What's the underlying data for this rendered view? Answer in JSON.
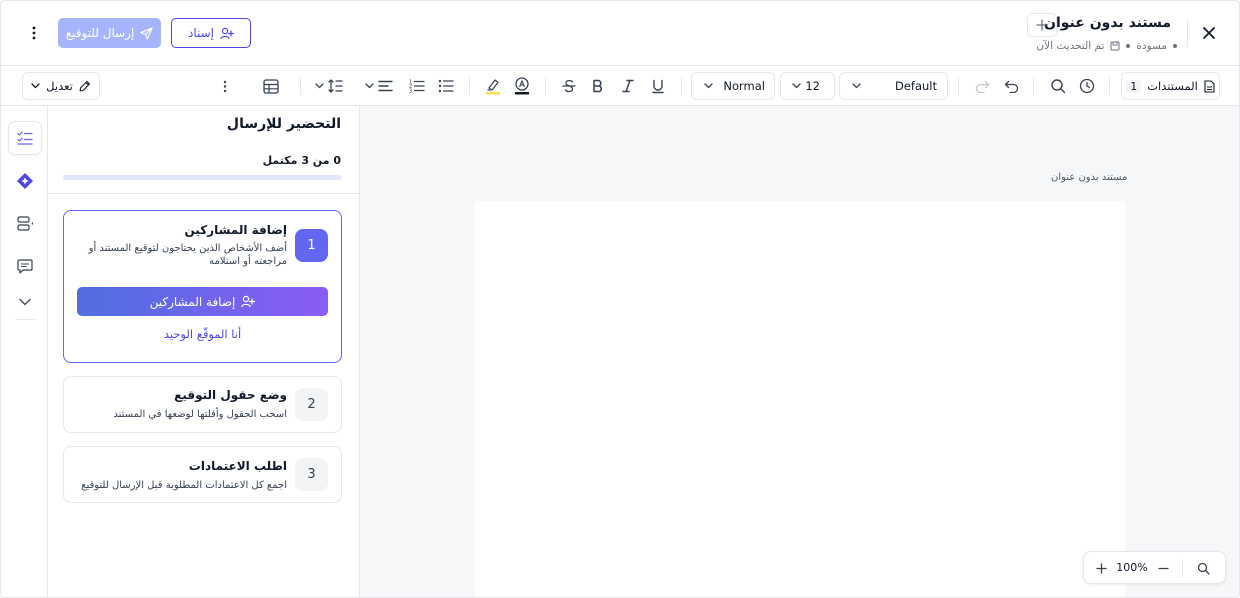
{
  "header": {
    "title": "مستند بدون عنوان",
    "status": "مسودة",
    "updated": "تم التحديث الآن",
    "assign_label": "إسناد",
    "send_label": "إرسال للتوقيع"
  },
  "toolbar": {
    "documents_label": "المستندات",
    "documents_count": "1",
    "font_family": "Default",
    "font_size": "12",
    "text_style": "Normal",
    "edit_label": "تعديل"
  },
  "panel": {
    "title": "التحضير للإرسال",
    "progress_label": "0 من 3 مكتمل",
    "progress": 0,
    "steps": [
      {
        "number": "1",
        "title": "إضافة المشاركين",
        "description": "أضف الأشخاص الذين يحتاجون لتوقيع المستند أو مراجعته أو استلامه",
        "action_label": "إضافة المشاركين",
        "link_label": "أنا الموقّع الوحيد"
      },
      {
        "number": "2",
        "title": "وضع حقول التوقيع",
        "description": "اسحب الحقول وأفلتها لوضعها في المستند"
      },
      {
        "number": "3",
        "title": "اطلب الاعتمادات",
        "description": "اجمع كل الاعتمادات المطلوبة قبل الإرسال للتوقيع"
      }
    ]
  },
  "canvas": {
    "page_label": "مستند بدون عنوان",
    "zoom": "100%"
  },
  "colors": {
    "accent": "#4f46e5",
    "accent_light": "#a5b4fc",
    "step_active": "#6366f1"
  }
}
